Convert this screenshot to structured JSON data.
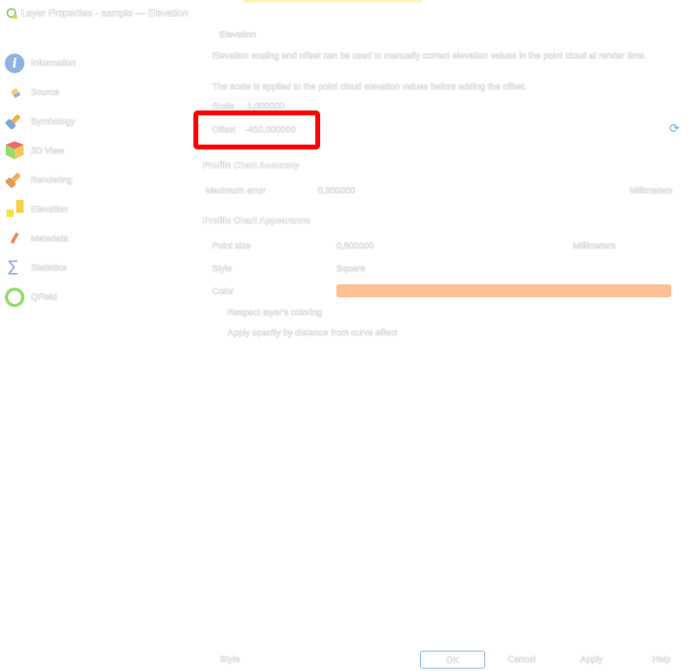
{
  "window": {
    "title": "Layer Properties - sample — Elevation"
  },
  "sidebar": {
    "items": [
      {
        "label": "Information",
        "icon": "info-icon"
      },
      {
        "label": "Source",
        "icon": "source-icon"
      },
      {
        "label": "Symbology",
        "icon": "paintbrush-icon"
      },
      {
        "label": "3D View",
        "icon": "cube-icon"
      },
      {
        "label": "Rendering",
        "icon": "paintbrush-icon"
      },
      {
        "label": "Elevation",
        "icon": "elevation-icon"
      },
      {
        "label": "Metadata",
        "icon": "pencil-icon"
      },
      {
        "label": "Statistics",
        "icon": "sigma-icon"
      },
      {
        "label": "QField",
        "icon": "qfield-icon"
      }
    ],
    "active_index": 5
  },
  "elevation": {
    "group_title": "Elevation",
    "description": "Elevation scaling and offset can be used to manually correct elevation values in the point cloud at render time.",
    "scale_note": "The scale is applied to the point cloud elevation values before adding the offset.",
    "scale_label": "Scale",
    "scale_value": "1,000000",
    "offset_label": "Offset",
    "offset_value": "-450,000000"
  },
  "accuracy": {
    "title": "Profile Chart Accuracy",
    "max_error_label": "Maximum error",
    "max_error_value": "0,300000",
    "max_error_unit": "Millimeters"
  },
  "appearance": {
    "title": "Profile Chart Appearance",
    "point_size_label": "Point size",
    "point_size_value": "0,600000",
    "point_size_unit": "Millimeters",
    "style_label": "Style",
    "style_value": "Square",
    "color_label": "Color",
    "color_value": "#ffbf94",
    "respect_coloring_label": "Respect layer's coloring",
    "apply_opacity_label": "Apply opacity by distance from curve effect"
  },
  "buttons": {
    "style": "Style",
    "ok": "OK",
    "cancel": "Cancel",
    "apply": "Apply",
    "help": "Help"
  },
  "colors": {
    "highlight": "#ff0000",
    "accent": "#6fa7e6"
  }
}
